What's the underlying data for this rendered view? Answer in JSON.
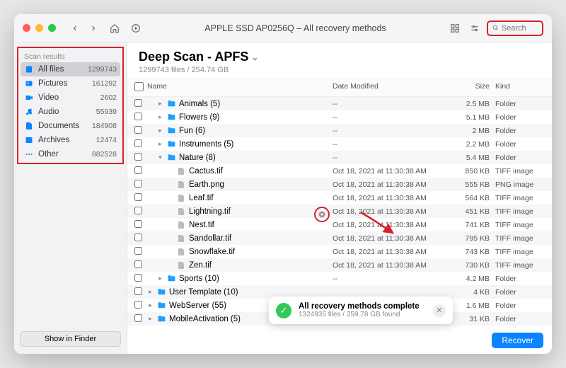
{
  "window_title": "APPLE SSD AP0256Q – All recovery methods",
  "search": {
    "placeholder": "Search"
  },
  "sidebar": {
    "group_title": "Scan results",
    "items": [
      {
        "icon": "files",
        "label": "All files",
        "count": "1299743",
        "active": true
      },
      {
        "icon": "pictures",
        "label": "Pictures",
        "count": "161292"
      },
      {
        "icon": "video",
        "label": "Video",
        "count": "2602"
      },
      {
        "icon": "audio",
        "label": "Audio",
        "count": "55939"
      },
      {
        "icon": "documents",
        "label": "Documents",
        "count": "184908"
      },
      {
        "icon": "archives",
        "label": "Archives",
        "count": "12474"
      },
      {
        "icon": "other",
        "label": "Other",
        "count": "882528"
      }
    ],
    "show_in_finder": "Show in Finder"
  },
  "header": {
    "title": "Deep Scan - APFS",
    "subtitle": "1299743 files / 254.74 GB"
  },
  "columns": {
    "name": "Name",
    "date": "Date Modified",
    "size": "Size",
    "kind": "Kind"
  },
  "rows": [
    {
      "indent": 1,
      "expand": "right",
      "type": "folder",
      "name": "Animals (5)",
      "date": "--",
      "size": "2.5 MB",
      "kind": "Folder"
    },
    {
      "indent": 1,
      "expand": "right",
      "type": "folder",
      "name": "Flowers (9)",
      "date": "--",
      "size": "5.1 MB",
      "kind": "Folder"
    },
    {
      "indent": 1,
      "expand": "right",
      "type": "folder",
      "name": "Fun (6)",
      "date": "--",
      "size": "2 MB",
      "kind": "Folder"
    },
    {
      "indent": 1,
      "expand": "right",
      "type": "folder",
      "name": "Instruments (5)",
      "date": "--",
      "size": "2.2 MB",
      "kind": "Folder"
    },
    {
      "indent": 1,
      "expand": "down",
      "type": "folder",
      "name": "Nature (8)",
      "date": "--",
      "size": "5.4 MB",
      "kind": "Folder"
    },
    {
      "indent": 2,
      "expand": "",
      "type": "file",
      "name": "Cactus.tif",
      "date": "Oct 18, 2021 at 11:30:38 AM",
      "size": "850 KB",
      "kind": "TIFF image"
    },
    {
      "indent": 2,
      "expand": "",
      "type": "file",
      "name": "Earth.png",
      "date": "Oct 18, 2021 at 11:30:38 AM",
      "size": "555 KB",
      "kind": "PNG image"
    },
    {
      "indent": 2,
      "expand": "",
      "type": "file",
      "name": "Leaf.tif",
      "date": "Oct 18, 2021 at 11:30:38 AM",
      "size": "564 KB",
      "kind": "TIFF image"
    },
    {
      "indent": 2,
      "expand": "",
      "type": "file",
      "name": "Lightning.tif",
      "date": "Oct 18, 2021 at 11:30:38 AM",
      "size": "451 KB",
      "kind": "TIFF image",
      "preview": true
    },
    {
      "indent": 2,
      "expand": "",
      "type": "file",
      "name": "Nest.tif",
      "date": "Oct 18, 2021 at 11:30:38 AM",
      "size": "741 KB",
      "kind": "TIFF image"
    },
    {
      "indent": 2,
      "expand": "",
      "type": "file",
      "name": "Sandollar.tif",
      "date": "Oct 18, 2021 at 11:30:38 AM",
      "size": "795 KB",
      "kind": "TIFF image"
    },
    {
      "indent": 2,
      "expand": "",
      "type": "file",
      "name": "Snowflake.tif",
      "date": "Oct 18, 2021 at 11:30:38 AM",
      "size": "743 KB",
      "kind": "TIFF image"
    },
    {
      "indent": 2,
      "expand": "",
      "type": "file",
      "name": "Zen.tif",
      "date": "Oct 18, 2021 at 11:30:38 AM",
      "size": "730 KB",
      "kind": "TIFF image"
    },
    {
      "indent": 1,
      "expand": "right",
      "type": "folder",
      "name": "Sports (10)",
      "date": "--",
      "size": "4.2 MB",
      "kind": "Folder"
    },
    {
      "indent": 0,
      "expand": "right",
      "type": "folder",
      "name": "User Template (10)",
      "date": "",
      "size": "4 KB",
      "kind": "Folder"
    },
    {
      "indent": 0,
      "expand": "right",
      "type": "folder",
      "name": "WebServer (55)",
      "date": "",
      "size": "1.6 MB",
      "kind": "Folder"
    },
    {
      "indent": 0,
      "expand": "right",
      "type": "folder",
      "name": "MobileActivation (5)",
      "date": "--",
      "size": "31 KB",
      "kind": "Folder"
    }
  ],
  "toast": {
    "title": "All recovery methods complete",
    "subtitle": "1324935 files / 259.78 GB found"
  },
  "recover_label": "Recover"
}
